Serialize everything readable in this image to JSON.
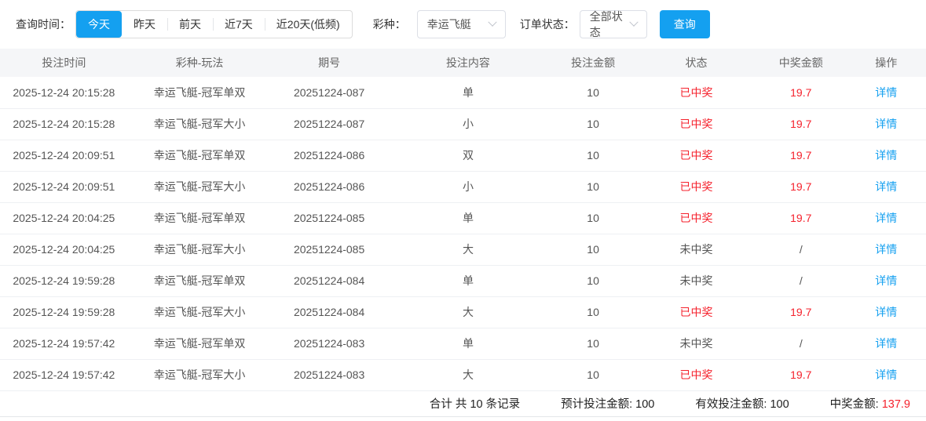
{
  "colors": {
    "blue": "#14a0f0",
    "red": "#f5222d"
  },
  "filters": {
    "time_label": "查询时间：",
    "time_options": [
      {
        "label": "今天",
        "active": true
      },
      {
        "label": "昨天",
        "active": false
      },
      {
        "label": "前天",
        "active": false
      },
      {
        "label": "近7天",
        "active": false
      },
      {
        "label": "近20天(低频)",
        "active": false
      }
    ],
    "lottery_label": "彩种：",
    "lottery_value": "幸运飞艇",
    "status_label": "订单状态：",
    "status_value": "全部状态",
    "search_button": "查询"
  },
  "table": {
    "headers": [
      "投注时间",
      "彩种-玩法",
      "期号",
      "投注内容",
      "投注金额",
      "状态",
      "中奖金额",
      "操作"
    ],
    "action_label": "详情",
    "rows": [
      {
        "time": "2025-12-24 20:15:28",
        "game": "幸运飞艇-冠军单双",
        "issue": "20251224-087",
        "content": "单",
        "amount": "10",
        "status": "已中奖",
        "won": true,
        "prize": "19.7"
      },
      {
        "time": "2025-12-24 20:15:28",
        "game": "幸运飞艇-冠军大小",
        "issue": "20251224-087",
        "content": "小",
        "amount": "10",
        "status": "已中奖",
        "won": true,
        "prize": "19.7"
      },
      {
        "time": "2025-12-24 20:09:51",
        "game": "幸运飞艇-冠军单双",
        "issue": "20251224-086",
        "content": "双",
        "amount": "10",
        "status": "已中奖",
        "won": true,
        "prize": "19.7"
      },
      {
        "time": "2025-12-24 20:09:51",
        "game": "幸运飞艇-冠军大小",
        "issue": "20251224-086",
        "content": "小",
        "amount": "10",
        "status": "已中奖",
        "won": true,
        "prize": "19.7"
      },
      {
        "time": "2025-12-24 20:04:25",
        "game": "幸运飞艇-冠军单双",
        "issue": "20251224-085",
        "content": "单",
        "amount": "10",
        "status": "已中奖",
        "won": true,
        "prize": "19.7"
      },
      {
        "time": "2025-12-24 20:04:25",
        "game": "幸运飞艇-冠军大小",
        "issue": "20251224-085",
        "content": "大",
        "amount": "10",
        "status": "未中奖",
        "won": false,
        "prize": "/"
      },
      {
        "time": "2025-12-24 19:59:28",
        "game": "幸运飞艇-冠军单双",
        "issue": "20251224-084",
        "content": "单",
        "amount": "10",
        "status": "未中奖",
        "won": false,
        "prize": "/"
      },
      {
        "time": "2025-12-24 19:59:28",
        "game": "幸运飞艇-冠军大小",
        "issue": "20251224-084",
        "content": "大",
        "amount": "10",
        "status": "已中奖",
        "won": true,
        "prize": "19.7"
      },
      {
        "time": "2025-12-24 19:57:42",
        "game": "幸运飞艇-冠军单双",
        "issue": "20251224-083",
        "content": "单",
        "amount": "10",
        "status": "未中奖",
        "won": false,
        "prize": "/"
      },
      {
        "time": "2025-12-24 19:57:42",
        "game": "幸运飞艇-冠军大小",
        "issue": "20251224-083",
        "content": "大",
        "amount": "10",
        "status": "已中奖",
        "won": true,
        "prize": "19.7"
      }
    ]
  },
  "summary": {
    "total_text": "合计 共 10 条记录",
    "expected_label": "预计投注金额:",
    "expected_value": "100",
    "valid_label": "有效投注金额:",
    "valid_value": "100",
    "prize_label": "中奖金额:",
    "prize_value": "137.9"
  }
}
